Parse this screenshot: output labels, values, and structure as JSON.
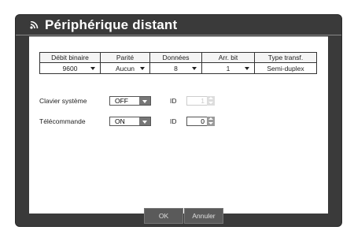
{
  "window": {
    "title": "Périphérique distant"
  },
  "table": {
    "headers": [
      "Débit binaire",
      "Parité",
      "Données",
      "Arr. bit",
      "Type transf."
    ],
    "values": [
      "9600",
      "Aucun",
      "8",
      "1",
      "Semi-duplex"
    ]
  },
  "keyboard": {
    "label": "Clavier système",
    "value": "OFF",
    "id_label": "ID",
    "id_value": "1"
  },
  "remote": {
    "label": "Télécommande",
    "value": "ON",
    "id_label": "ID",
    "id_value": "0"
  },
  "buttons": {
    "ok": "OK",
    "cancel": "Annuler"
  }
}
